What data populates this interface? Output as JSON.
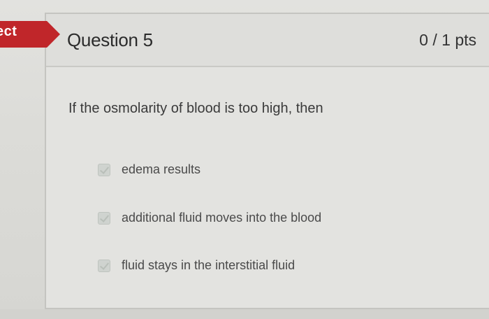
{
  "status": {
    "label": "ect",
    "color": "#c0262a"
  },
  "question": {
    "title": "Question 5",
    "points": "0 / 1 pts",
    "text": "If the osmolarity of blood is too high, then"
  },
  "answers": [
    {
      "label": "edema results"
    },
    {
      "label": "additional fluid moves into the blood"
    },
    {
      "label": "fluid stays in the interstitial fluid"
    }
  ]
}
